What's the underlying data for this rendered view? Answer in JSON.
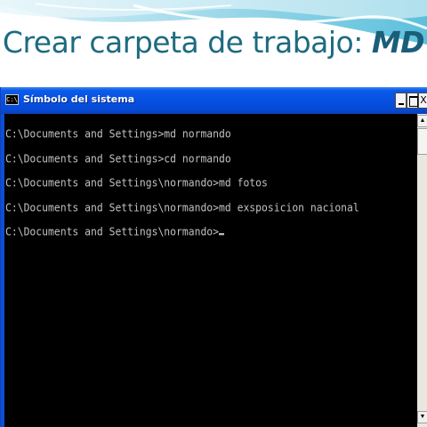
{
  "slide": {
    "title_prefix": "Crear carpeta de trabajo: ",
    "title_emphasis": "MD"
  },
  "window": {
    "title": "Símbolo del sistema",
    "icon_text": "C:\\",
    "buttons": {
      "minimize": "_",
      "maximize": "□",
      "close": "X"
    },
    "scroll_up": "▲",
    "scroll_down": "▼"
  },
  "console": {
    "lines": [
      "C:\\Documents and Settings>md normando",
      "C:\\Documents and Settings>cd normando",
      "C:\\Documents and Settings\\normando>md fotos",
      "C:\\Documents and Settings\\normando>md exsposicion nacional",
      "C:\\Documents and Settings\\normando>"
    ]
  },
  "colors": {
    "title_text": "#1d6b80",
    "titlebar": "#0750e0",
    "console_bg": "#000000",
    "console_text": "#c0c0c0"
  }
}
